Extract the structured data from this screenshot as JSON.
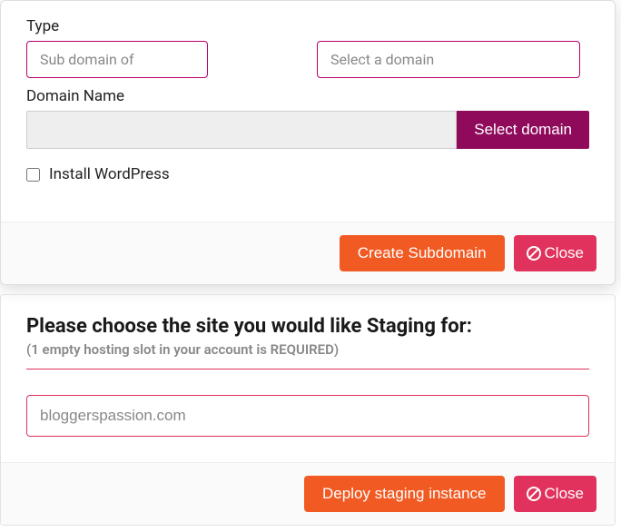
{
  "modal1": {
    "type_label": "Type",
    "subdomain_select": "Sub domain of",
    "domain_select_placeholder": "Select a domain",
    "domain_name_label": "Domain Name",
    "domain_value": "",
    "select_domain_btn": "Select domain",
    "install_wp_label": "Install WordPress",
    "create_btn": "Create Subdomain",
    "close_btn": "Close"
  },
  "modal2": {
    "heading": "Please choose the site you would like Staging for:",
    "subnote": "(1 empty hosting slot in your account is REQUIRED)",
    "site_value": "bloggerspassion.com",
    "deploy_btn": "Deploy staging instance",
    "close_btn": "Close"
  }
}
